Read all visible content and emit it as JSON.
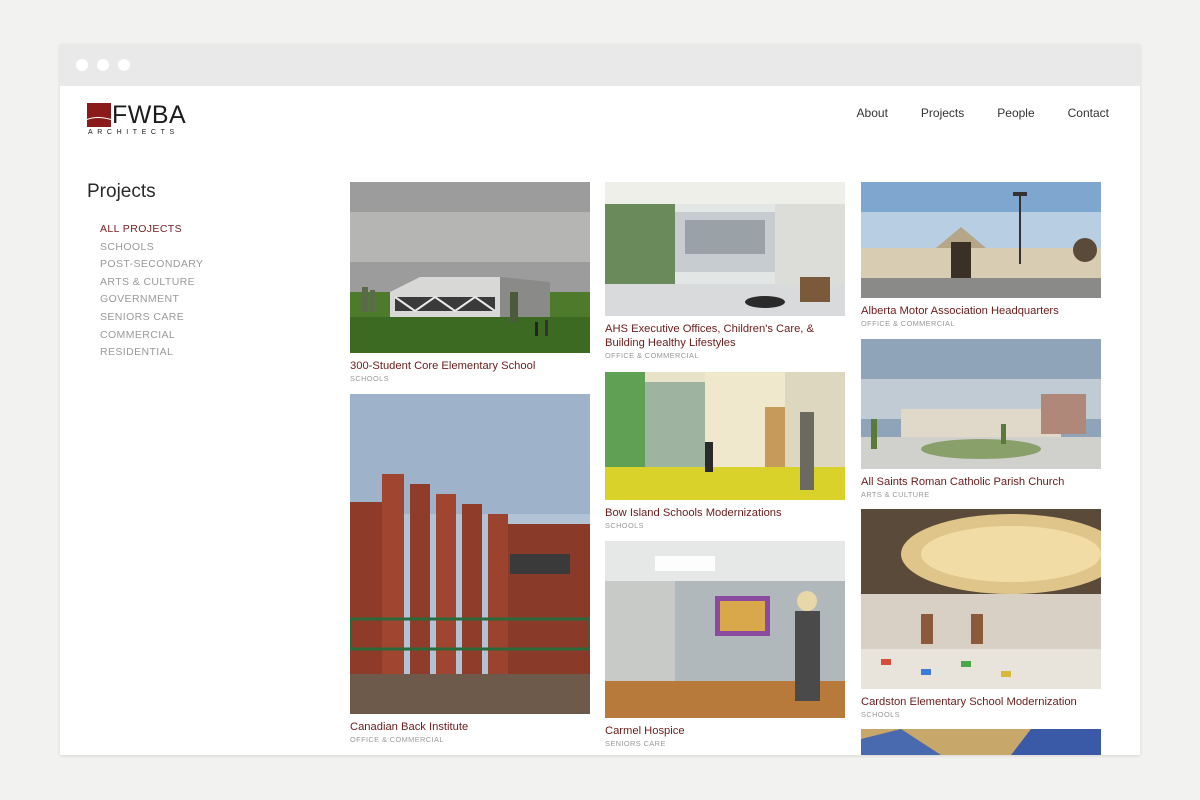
{
  "brand": {
    "name": "FWBA",
    "subtitle": "ARCHITECTS",
    "color": "#8b1a1a"
  },
  "nav": {
    "items": [
      "About",
      "Projects",
      "People",
      "Contact"
    ]
  },
  "sidebar": {
    "title": "Projects",
    "active_color": "#7a1d1d",
    "items": [
      {
        "label": "ALL PROJECTS",
        "active": true
      },
      {
        "label": "SCHOOLS",
        "active": false
      },
      {
        "label": "POST-SECONDARY",
        "active": false
      },
      {
        "label": "ARTS & CULTURE",
        "active": false
      },
      {
        "label": "GOVERNMENT",
        "active": false
      },
      {
        "label": "SENIORS CARE",
        "active": false
      },
      {
        "label": "COMMERCIAL",
        "active": false
      },
      {
        "label": "RESIDENTIAL",
        "active": false
      }
    ]
  },
  "projects": [
    {
      "title": "300-Student Core Elementary School",
      "category": "SCHOOLS",
      "image": "school-rendering"
    },
    {
      "title": "Canadian Back Institute",
      "category": "OFFICE & COMMERCIAL",
      "image": "brick-building"
    },
    {
      "title": "AHS Executive Offices, Children's Care, & Building Healthy Lifestyles",
      "category": "OFFICE & COMMERCIAL",
      "image": "office-interior"
    },
    {
      "title": "Bow Island Schools Modernizations",
      "category": "SCHOOLS",
      "image": "school-hallway"
    },
    {
      "title": "Carmel Hospice",
      "category": "SENIORS CARE",
      "image": "hospice-corridor"
    },
    {
      "title": "Alberta Motor Association Headquarters",
      "category": "OFFICE & COMMERCIAL",
      "image": "ama-building"
    },
    {
      "title": "All Saints Roman Catholic Parish Church",
      "category": "ARTS & CULTURE",
      "image": "church-rendering"
    },
    {
      "title": "Cardston Elementary School Modernization",
      "category": "SCHOOLS",
      "image": "gym-ceiling"
    }
  ]
}
